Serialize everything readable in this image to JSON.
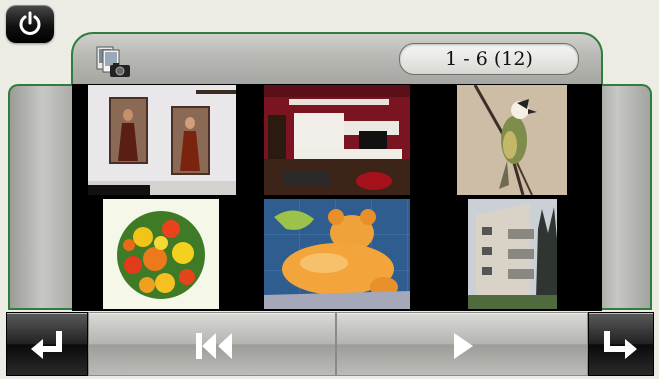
{
  "header": {
    "page_counter": "1 - 6 (12)",
    "accent_color": "#2e7d3c"
  },
  "icons": {
    "power": "power-icon",
    "gallery": "photo-gallery-icon",
    "back": "back-arrow-icon",
    "previous": "skip-previous-icon",
    "play": "play-icon",
    "next_page": "next-page-arrow-icon"
  },
  "gallery": {
    "photos": [
      {
        "subject": "painting-wall"
      },
      {
        "subject": "living-room"
      },
      {
        "subject": "bird-on-branch"
      },
      {
        "subject": "flower-bouquet"
      },
      {
        "subject": "teddy-bear-art"
      },
      {
        "subject": "apartment-building"
      }
    ]
  }
}
